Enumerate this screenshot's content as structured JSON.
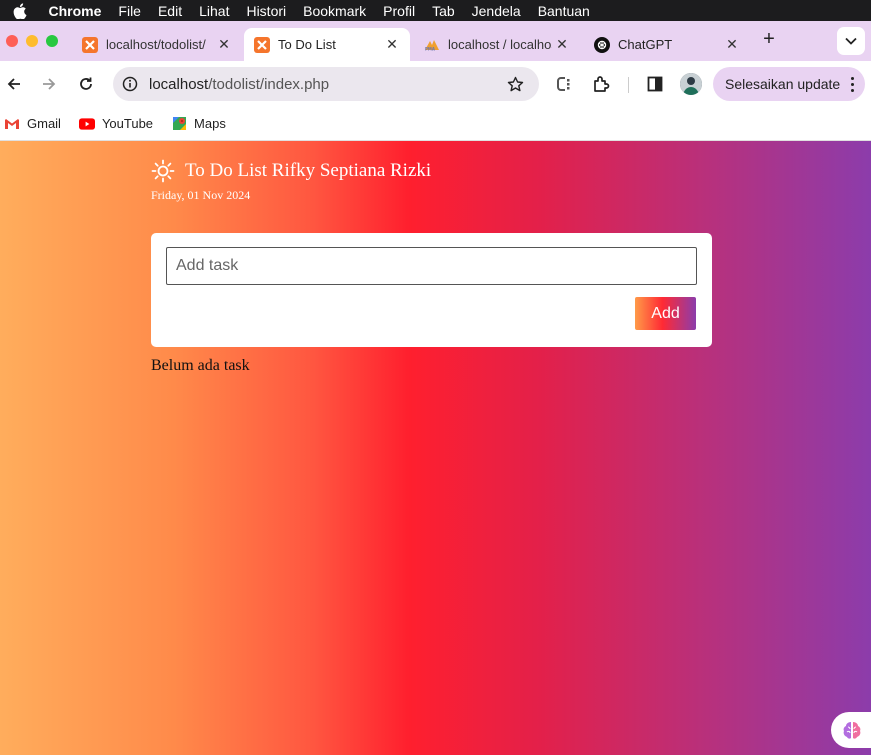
{
  "menubar": {
    "items": [
      "Chrome",
      "File",
      "Edit",
      "Lihat",
      "Histori",
      "Bookmark",
      "Profil",
      "Tab",
      "Jendela",
      "Bantuan"
    ]
  },
  "tabs": [
    {
      "label": "localhost/todolist/",
      "favicon": "xampp-icon",
      "active": false
    },
    {
      "label": "To Do List",
      "favicon": "xampp-icon",
      "active": true
    },
    {
      "label": "localhost / localhost",
      "favicon": "phpmyadmin-icon",
      "active": false
    },
    {
      "label": "ChatGPT",
      "favicon": "chatgpt-icon",
      "active": false
    }
  ],
  "toolbar": {
    "url_host": "localhost",
    "url_path": "/todolist/index.php",
    "update_label": "Selesaikan update"
  },
  "bookmarks": [
    {
      "label": "Gmail",
      "icon": "gmail-icon"
    },
    {
      "label": "YouTube",
      "icon": "youtube-icon"
    },
    {
      "label": "Maps",
      "icon": "maps-icon"
    }
  ],
  "app": {
    "title": "To Do List Rifky Septiana Rizki",
    "date": "Friday, 01 Nov 2024",
    "input_placeholder": "Add task",
    "add_label": "Add",
    "empty_message": "Belum ada task"
  },
  "colors": {
    "tab_strip": "#e9d3f2",
    "gradient_left": "#ffad5c",
    "gradient_mid": "#ff1f2e",
    "gradient_right": "#8c3cab"
  }
}
